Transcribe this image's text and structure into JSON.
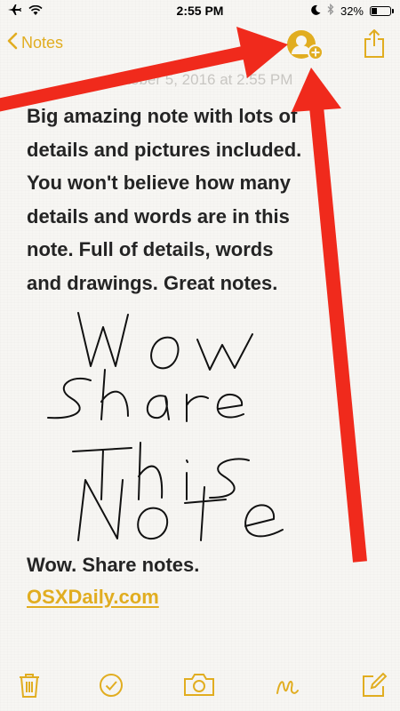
{
  "status_bar": {
    "time": "2:55 PM",
    "battery": "32%",
    "battery_level": 0.32,
    "icons": [
      "airplane-icon",
      "wifi-icon",
      "moon-icon",
      "bluetooth-icon",
      "battery-icon"
    ]
  },
  "nav": {
    "back_label": "Notes",
    "icons": [
      "chevron-left-icon",
      "add-people-icon",
      "share-icon"
    ]
  },
  "note": {
    "date": "October 5, 2016 at 2:55 PM",
    "lines": [
      "Big amazing note with lots of",
      "details and pictures included.",
      "You won't believe how many",
      "details and words are in this",
      "note. Full of details, words",
      "and drawings. Great notes."
    ],
    "drawing_text": "Wow Share This Note",
    "footer_text": "Wow. Share notes.",
    "link_text": "OSXDaily.com"
  },
  "toolbar": {
    "icons": [
      "trash-icon",
      "checklist-icon",
      "camera-icon",
      "sketch-icon",
      "compose-icon"
    ]
  },
  "colors": {
    "accent": "#e1ad20",
    "arrow": "#f02a1c",
    "text": "#242424",
    "date": "#c8c6c2"
  }
}
